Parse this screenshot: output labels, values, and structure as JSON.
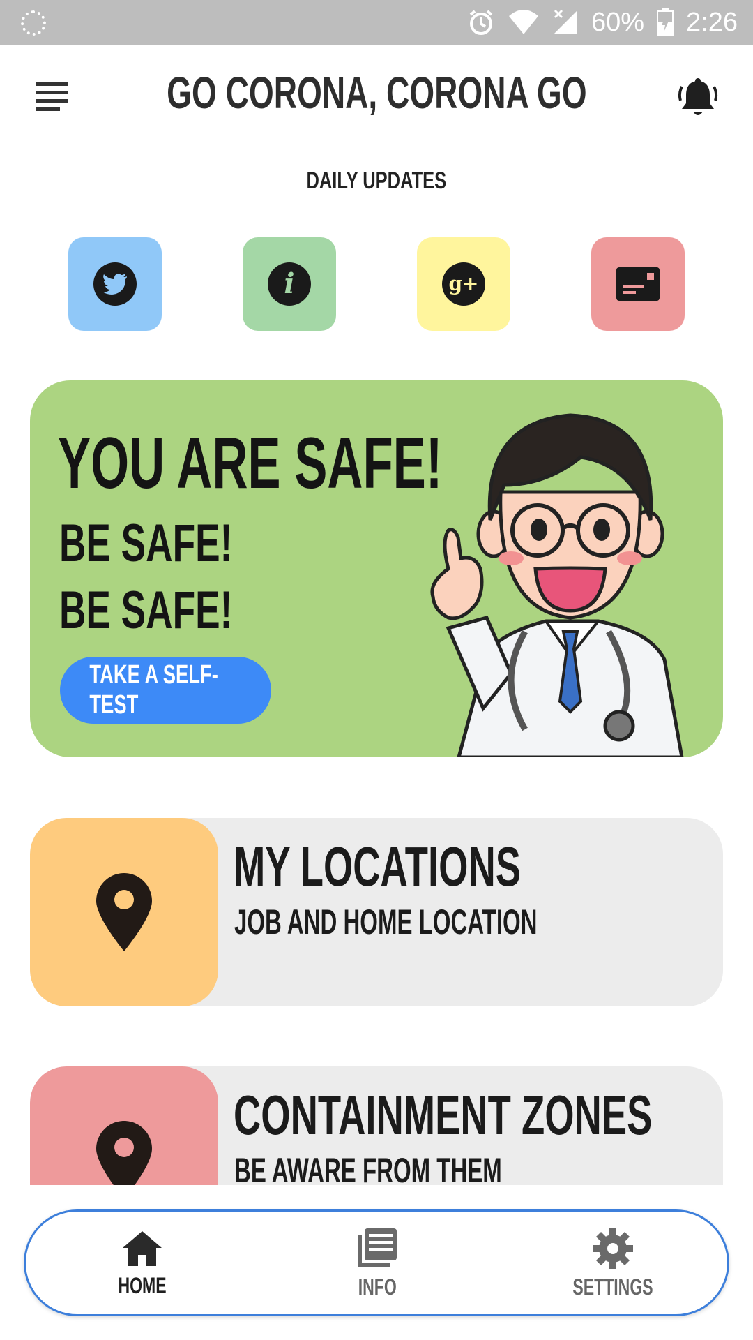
{
  "status_bar": {
    "battery": "60%",
    "time": "2:26"
  },
  "header": {
    "title": "GO CORONA, CORONA GO"
  },
  "daily_updates": {
    "label": "DAILY UPDATES"
  },
  "quick_links": [
    {
      "name": "twitter-icon",
      "color": "#90c8f8"
    },
    {
      "name": "info-icon",
      "color": "#a4d7a6"
    },
    {
      "name": "google-plus-icon",
      "color": "#fff59d"
    },
    {
      "name": "news-card-icon",
      "color": "#ee9a9b"
    }
  ],
  "safe_card": {
    "headline": "YOU ARE SAFE!",
    "line1": "BE SAFE!",
    "line2": "BE SAFE!",
    "button": "TAKE A SELF-TEST",
    "background": "#acd481",
    "button_color": "#3d8af7"
  },
  "cards": {
    "locations": {
      "title": "MY LOCATIONS",
      "subtitle": "JOB AND HOME LOCATION",
      "icon_bg": "#fecb7e"
    },
    "zones": {
      "title": "CONTAINMENT ZONES",
      "subtitle": "BE AWARE FROM THEM",
      "icon_bg": "#ee9a9b"
    }
  },
  "bottom_nav": {
    "home": "HOME",
    "info": "INFO",
    "settings": "SETTINGS",
    "active": "HOME",
    "border_color": "#3d7fdb"
  }
}
